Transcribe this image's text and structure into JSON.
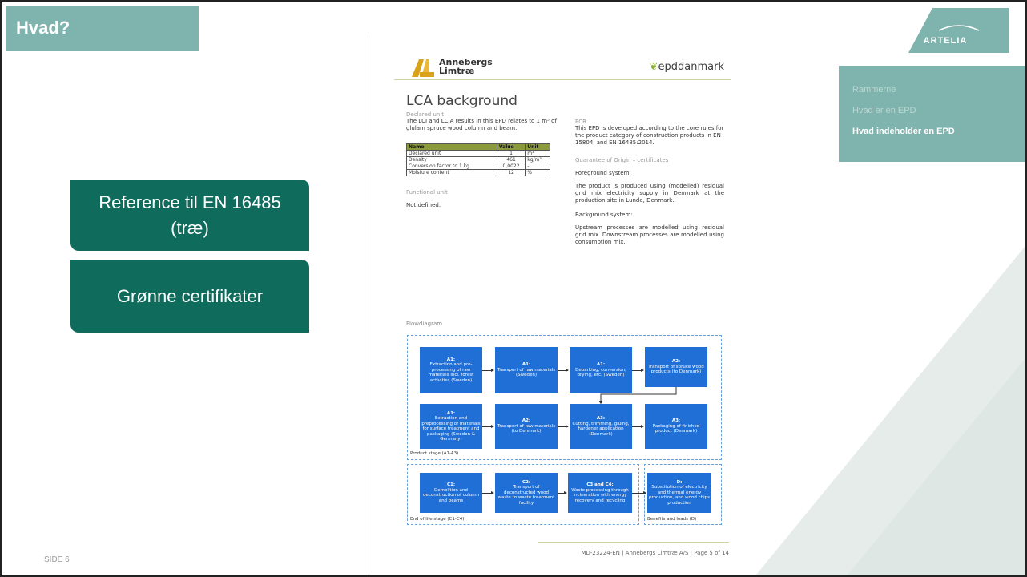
{
  "slide": {
    "title": "Hvad?",
    "slide_number": "SIDE 6",
    "callouts": [
      "Reference til EN 16485 (træ)",
      "Grønne certifikater"
    ],
    "brand": "ARTELIA",
    "colors": {
      "teal_light": "#7fb3ad",
      "teal_dark": "#0f6b5c",
      "flow_blue": "#1f6fd6"
    }
  },
  "nav": {
    "items": [
      {
        "label": "Rammerne",
        "active": false
      },
      {
        "label": "Hvad er en EPD",
        "active": false
      },
      {
        "label": "Hvad indeholder en EPD",
        "active": true
      }
    ]
  },
  "doc": {
    "logo_left_line1": "Annebergs",
    "logo_left_line2": "Limtræ",
    "logo_right": "epddanmark",
    "title": "LCA background",
    "declared_unit_heading": "Declared unit",
    "declared_unit_text": "The LCI and LCIA results in this EPD relates to 1 m³ of glulam spruce wood column and beam.",
    "table": {
      "headers": [
        "Name",
        "Value",
        "Unit"
      ],
      "rows": [
        [
          "Declared unit",
          "1",
          "m³"
        ],
        [
          "Density",
          "461",
          "kg/m³"
        ],
        [
          "Conversion factor to 1 kg.",
          "0,0022",
          "-"
        ],
        [
          "Moisture content",
          "12",
          "%"
        ]
      ]
    },
    "functional_unit_heading": "Functional unit",
    "functional_unit_text": "Not defined.",
    "pcr_heading": "PCR",
    "pcr_text": "This EPD is developed according to the core rules for the product category of construction products in EN 15804, and EN 16485:2014.",
    "guarantee_heading": "Guarantee of Origin – certificates",
    "foreground_heading": "Foreground system:",
    "foreground_text": "The product is produced using (modelled) residual grid mix electricity supply in Denmark at the production site in Lunde, Denmark.",
    "background_heading": "Background system:",
    "background_text": "Upstream processes are modelled using residual grid mix. Downstream processes are modelled using consumption mix.",
    "flow_title": "Flowdiagram",
    "flow_boxes": [
      {
        "head": "A1:",
        "body": "Extraction and pre-processing of raw materials incl. forest activities (Sweden)"
      },
      {
        "head": "A1:",
        "body": "Transport of raw materials (Sweden)"
      },
      {
        "head": "A1:",
        "body": "Debarking, conversion, drying, etc. (Sweden)"
      },
      {
        "head": "A2:",
        "body": "Transport of spruce wood products (to Denmark)"
      },
      {
        "head": "A1:",
        "body": "Extraction and preprocessing of materials for surface treatment and packaging (Sweden & Germany)"
      },
      {
        "head": "A2:",
        "body": "Transport of raw materials (to Denmark)"
      },
      {
        "head": "A3:",
        "body": "Cutting, trimming, gluing, hardener application (Denmark)"
      },
      {
        "head": "A3:",
        "body": "Packaging of finished product (Denmark)"
      },
      {
        "head": "C1:",
        "body": "Demolition and deconstruction of column and beams"
      },
      {
        "head": "C2:",
        "body": "Transport of deconstructed wood waste to waste treatment facility"
      },
      {
        "head": "C3 and C4:",
        "body": "Waste processing through incineration with energy recovery and recycling"
      },
      {
        "head": "D:",
        "body": "Substitution of electricity and thermal energy production, and wood chips production"
      }
    ],
    "stage_labels": [
      "Product stage (A1-A3)",
      "End of life stage (C1-C4)",
      "Benefits and loads (D)"
    ],
    "footer": "MD-23224-EN | Annebergs Limtræ A/S | Page 5 of 14"
  }
}
